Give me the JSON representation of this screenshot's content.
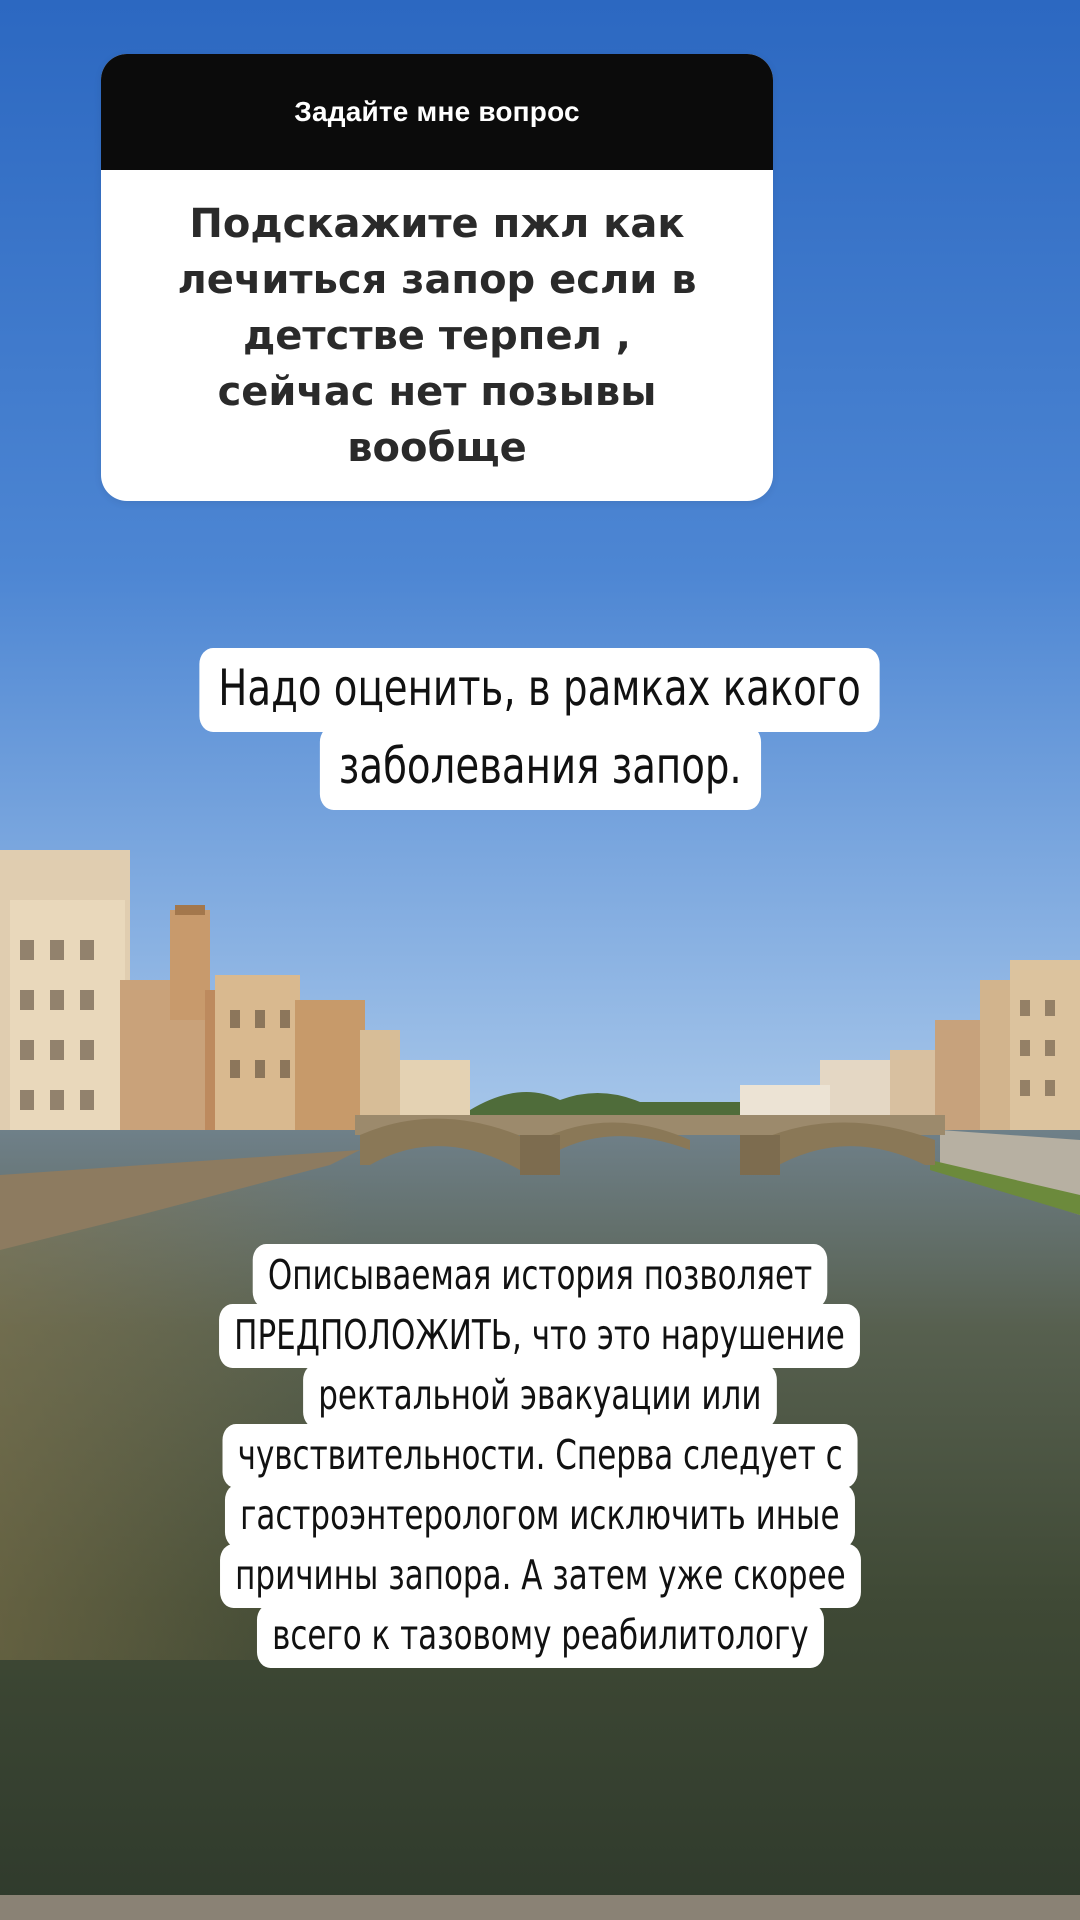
{
  "question_sticker": {
    "header": "Задайте мне вопрос",
    "question": "Подскажите пжл как лечиться запор если в детстве терпел , сейчас нет позывы вообще"
  },
  "answer_caption_1": {
    "lines": [
      "Надо оценить, в рамках какого",
      "заболевания запор."
    ]
  },
  "answer_caption_2": {
    "lines": [
      "Описываемая история позволяет",
      "ПРЕДПОЛОЖИТЬ,  что это нарушение",
      "ректальной эвакуации или",
      "чувствительности. Сперва следует с",
      "гастроэнтерологом исключить иные",
      "причины запора. А затем уже скорее",
      "всего к тазовому реабилитологу"
    ]
  },
  "background": {
    "sky_color": "#2f6fc4",
    "water_color": "#3d4a3c",
    "building_color": "#c9a77c"
  }
}
